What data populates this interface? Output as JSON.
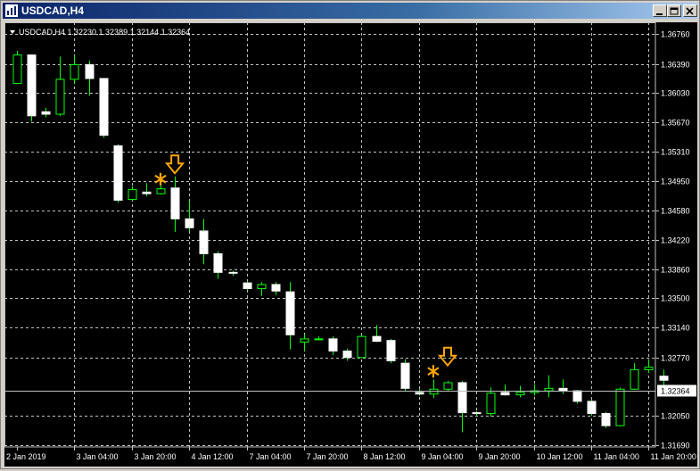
{
  "window": {
    "title": "USDCAD,H4",
    "buttons": [
      "minimize",
      "maximize",
      "close"
    ]
  },
  "chart_header": "USDCAD,H4  1.32230 1.32389 1.32144 1.32364",
  "current_price_label": "1.32364",
  "colors": {
    "background": "#000000",
    "grid": "#c0c0c0",
    "bull_body": "#000000",
    "bear_body": "#ffffff",
    "wick": "#00ff00",
    "marker": "#ffa500",
    "text": "#ffffff"
  },
  "chart_data": {
    "type": "candlestick",
    "symbol": "USDCAD",
    "timeframe": "H4",
    "ylim": [
      1.3169,
      1.3676
    ],
    "y_ticks": [
      "1.36760",
      "1.36390",
      "1.36030",
      "1.35670",
      "1.35310",
      "1.34950",
      "1.34580",
      "1.34220",
      "1.33860",
      "1.33500",
      "1.33140",
      "1.32770",
      "1.32050",
      "1.31690"
    ],
    "x_ticks": [
      "2 Jan 2019",
      "3 Jan 04:00",
      "3 Jan 20:00",
      "4 Jan 12:00",
      "7 Jan 04:00",
      "7 Jan 20:00",
      "8 Jan 12:00",
      "9 Jan 04:00",
      "9 Jan 20:00",
      "10 Jan 12:00",
      "11 Jan 04:00",
      "11 Jan 20:00"
    ],
    "grid": true,
    "current_price": 1.32364,
    "candles": [
      {
        "o": 1.3615,
        "h": 1.3655,
        "l": 1.3625,
        "c": 1.365
      },
      {
        "o": 1.365,
        "h": 1.365,
        "l": 1.3568,
        "c": 1.3575
      },
      {
        "o": 1.358,
        "h": 1.3585,
        "l": 1.3573,
        "c": 1.3577
      },
      {
        "o": 1.3577,
        "h": 1.3648,
        "l": 1.3575,
        "c": 1.362
      },
      {
        "o": 1.362,
        "h": 1.365,
        "l": 1.3615,
        "c": 1.3638
      },
      {
        "o": 1.3638,
        "h": 1.3643,
        "l": 1.36,
        "c": 1.3621
      },
      {
        "o": 1.3621,
        "h": 1.3621,
        "l": 1.3548,
        "c": 1.3551
      },
      {
        "o": 1.3538,
        "h": 1.354,
        "l": 1.3468,
        "c": 1.3471
      },
      {
        "o": 1.3472,
        "h": 1.3488,
        "l": 1.347,
        "c": 1.3484
      },
      {
        "o": 1.3481,
        "h": 1.3492,
        "l": 1.3476,
        "c": 1.3479
      },
      {
        "o": 1.3479,
        "h": 1.3494,
        "l": 1.3478,
        "c": 1.3485
      },
      {
        "o": 1.3486,
        "h": 1.35,
        "l": 1.3432,
        "c": 1.3448
      },
      {
        "o": 1.3448,
        "h": 1.347,
        "l": 1.3433,
        "c": 1.3437
      },
      {
        "o": 1.3433,
        "h": 1.3448,
        "l": 1.3392,
        "c": 1.3405
      },
      {
        "o": 1.3405,
        "h": 1.3408,
        "l": 1.3374,
        "c": 1.3382
      },
      {
        "o": 1.3382,
        "h": 1.3384,
        "l": 1.3378,
        "c": 1.3381
      },
      {
        "o": 1.3369,
        "h": 1.3371,
        "l": 1.336,
        "c": 1.3362
      },
      {
        "o": 1.3362,
        "h": 1.337,
        "l": 1.3353,
        "c": 1.3367
      },
      {
        "o": 1.3367,
        "h": 1.337,
        "l": 1.3354,
        "c": 1.3359
      },
      {
        "o": 1.3358,
        "h": 1.337,
        "l": 1.3287,
        "c": 1.3305
      },
      {
        "o": 1.3296,
        "h": 1.3305,
        "l": 1.3285,
        "c": 1.33
      },
      {
        "o": 1.33,
        "h": 1.3303,
        "l": 1.3299,
        "c": 1.33
      },
      {
        "o": 1.33,
        "h": 1.3303,
        "l": 1.328,
        "c": 1.3285
      },
      {
        "o": 1.3285,
        "h": 1.3288,
        "l": 1.3273,
        "c": 1.3277
      },
      {
        "o": 1.3277,
        "h": 1.3305,
        "l": 1.3277,
        "c": 1.3303
      },
      {
        "o": 1.3303,
        "h": 1.3317,
        "l": 1.3296,
        "c": 1.3297
      },
      {
        "o": 1.3298,
        "h": 1.33,
        "l": 1.327,
        "c": 1.3273
      },
      {
        "o": 1.327,
        "h": 1.3275,
        "l": 1.3236,
        "c": 1.3239
      },
      {
        "o": 1.3234,
        "h": 1.3238,
        "l": 1.323,
        "c": 1.3232
      },
      {
        "o": 1.3232,
        "h": 1.325,
        "l": 1.3227,
        "c": 1.3238
      },
      {
        "o": 1.3238,
        "h": 1.3248,
        "l": 1.3236,
        "c": 1.3246
      },
      {
        "o": 1.3246,
        "h": 1.3248,
        "l": 1.3185,
        "c": 1.3209
      },
      {
        "o": 1.3209,
        "h": 1.3211,
        "l": 1.3205,
        "c": 1.3208
      },
      {
        "o": 1.3208,
        "h": 1.324,
        "l": 1.3204,
        "c": 1.3233
      },
      {
        "o": 1.3234,
        "h": 1.3244,
        "l": 1.323,
        "c": 1.3231
      },
      {
        "o": 1.3231,
        "h": 1.3242,
        "l": 1.3228,
        "c": 1.3234
      },
      {
        "o": 1.3234,
        "h": 1.3244,
        "l": 1.323,
        "c": 1.3236
      },
      {
        "o": 1.3236,
        "h": 1.3255,
        "l": 1.3228,
        "c": 1.3239
      },
      {
        "o": 1.3239,
        "h": 1.325,
        "l": 1.3232,
        "c": 1.3236
      },
      {
        "o": 1.3236,
        "h": 1.3237,
        "l": 1.322,
        "c": 1.3223
      },
      {
        "o": 1.3223,
        "h": 1.3225,
        "l": 1.3205,
        "c": 1.3208
      },
      {
        "o": 1.3208,
        "h": 1.321,
        "l": 1.319,
        "c": 1.3193
      },
      {
        "o": 1.3193,
        "h": 1.324,
        "l": 1.3192,
        "c": 1.3238
      },
      {
        "o": 1.3238,
        "h": 1.327,
        "l": 1.3237,
        "c": 1.3262
      },
      {
        "o": 1.3262,
        "h": 1.3275,
        "l": 1.3258,
        "c": 1.3265
      },
      {
        "o": 1.3254,
        "h": 1.3262,
        "l": 1.324,
        "c": 1.3249
      }
    ],
    "markers": [
      {
        "type": "star",
        "candle": 10,
        "price": 1.3497
      },
      {
        "type": "down-arrow",
        "candle": 11,
        "price": 1.3513
      },
      {
        "type": "star",
        "candle": 29,
        "price": 1.326
      },
      {
        "type": "down-arrow",
        "candle": 30,
        "price": 1.3276
      }
    ]
  }
}
